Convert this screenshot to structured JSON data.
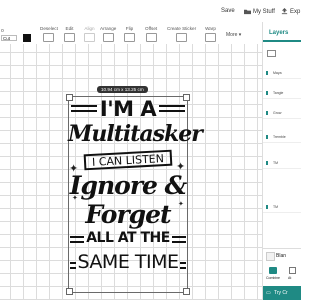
{
  "header": {
    "save": "Save",
    "my_stuff": "My Stuff",
    "export": "Exp"
  },
  "toolbar": {
    "left_value": "o",
    "operation": "Cut",
    "tools": [
      "Deselect",
      "Edit",
      "Align",
      "Arrange",
      "Flip",
      "Offset",
      "Create Sticker",
      "Warp"
    ],
    "more": "More"
  },
  "canvas": {
    "size_label": "10.94 cm x 13.25 cm",
    "design_lines": [
      "I'M A",
      "Multitasker",
      "I CAN LISTEN",
      "Ignore &",
      "Forget",
      "ALL AT THE",
      "SAME TIME"
    ]
  },
  "layers_panel": {
    "tab_label": "Layers",
    "items": [
      "Maya",
      "Tangle",
      "Grow",
      "Tremble",
      "TM",
      "TM"
    ],
    "blank_label": "Blan",
    "combine_label": "Combine",
    "attach_label": "At",
    "try_button": "Try Cr"
  },
  "colors": {
    "accent": "#1f8a84",
    "try_button_bg": "#1f8a84",
    "grid": "#dcdcdc"
  }
}
